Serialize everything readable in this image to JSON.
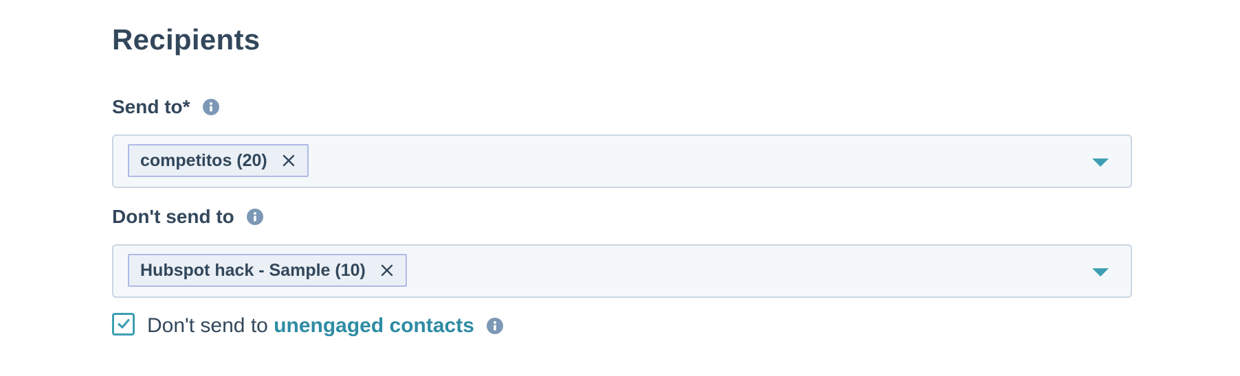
{
  "section": {
    "title": "Recipients"
  },
  "send_to": {
    "label": "Send to*",
    "info_icon": "info-icon",
    "tags": [
      {
        "label": "competitos (20)"
      }
    ],
    "dropdown_icon": "caret-down-icon"
  },
  "dont_send_to": {
    "label": "Don't send to",
    "info_icon": "info-icon",
    "tags": [
      {
        "label": "Hubspot hack - Sample (10)"
      }
    ],
    "dropdown_icon": "caret-down-icon"
  },
  "unengaged": {
    "checked": true,
    "text_prefix": "Don't send to",
    "link_text": "unengaged contacts",
    "info_icon": "info-icon"
  },
  "colors": {
    "heading": "#33475b",
    "accent": "#3d9fb1",
    "link": "#2e8ba3",
    "field_bg": "#f5f8fa",
    "field_border": "#cbd6e2",
    "tag_border": "#b0b9e6",
    "info_icon": "#7c98b6"
  }
}
